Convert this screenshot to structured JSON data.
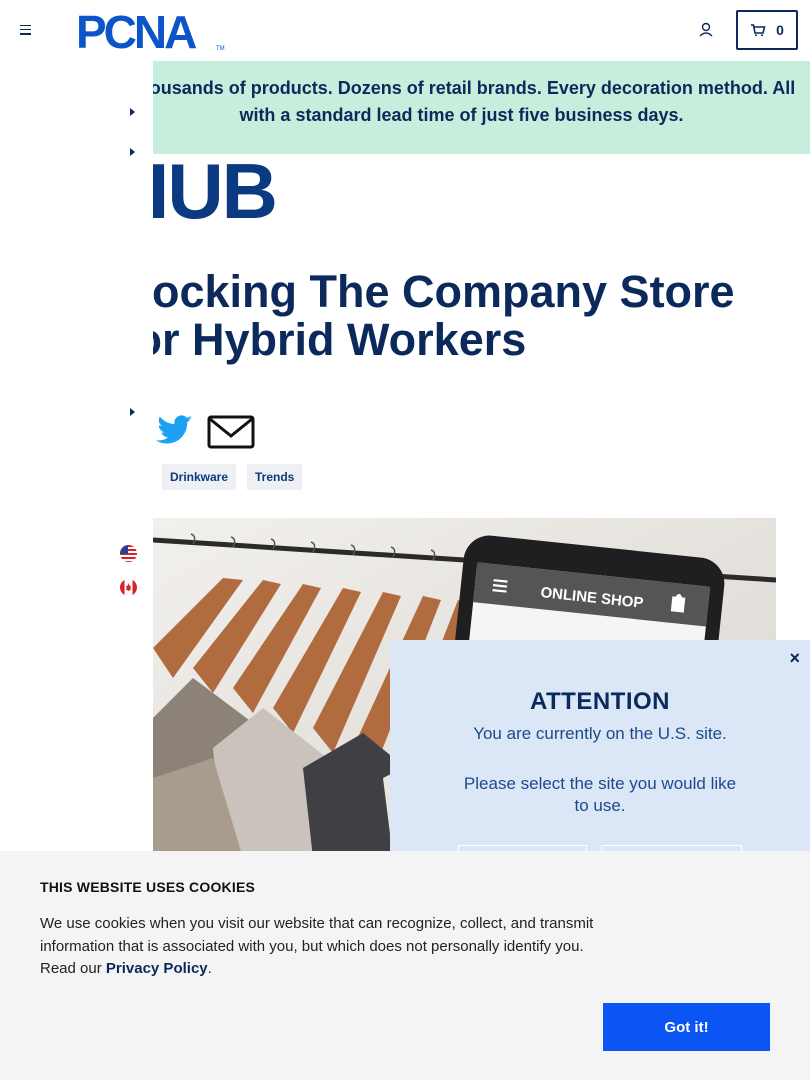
{
  "header": {
    "logo_alt": "PCNA",
    "cart_count": "0",
    "brand_color": "#0b2a5b"
  },
  "banner": {
    "text": "Thousands of products. Dozens of retail brands. Every decoration method. All with a standard lead time of just five business days."
  },
  "hub": {
    "label": "HUB"
  },
  "article": {
    "title": "Stocking The Company Store For Hybrid Workers",
    "tags": [
      "Drinkware",
      "Trends"
    ]
  },
  "hero_screen": {
    "label": "ONLINE SHOP"
  },
  "attention_modal": {
    "title": "ATTENTION",
    "message": "You are currently on the U.S. site.",
    "question": "Please select the site you would like to use.",
    "close_label": "×"
  },
  "cookie_bar": {
    "title": "THIS WEBSITE USES COOKIES",
    "body": "We use cookies when you visit our website that can recognize, collect, and transmit information that is associated with you, but which does not personally identify you. Read our",
    "link": "Privacy Policy",
    "period": ".",
    "button": "Got it!"
  },
  "colors": {
    "banner_bg": "#c6eedc",
    "modal_bg": "#dbe6f6",
    "cookie_button": "#0b55f5",
    "twitter": "#1da1f2"
  }
}
